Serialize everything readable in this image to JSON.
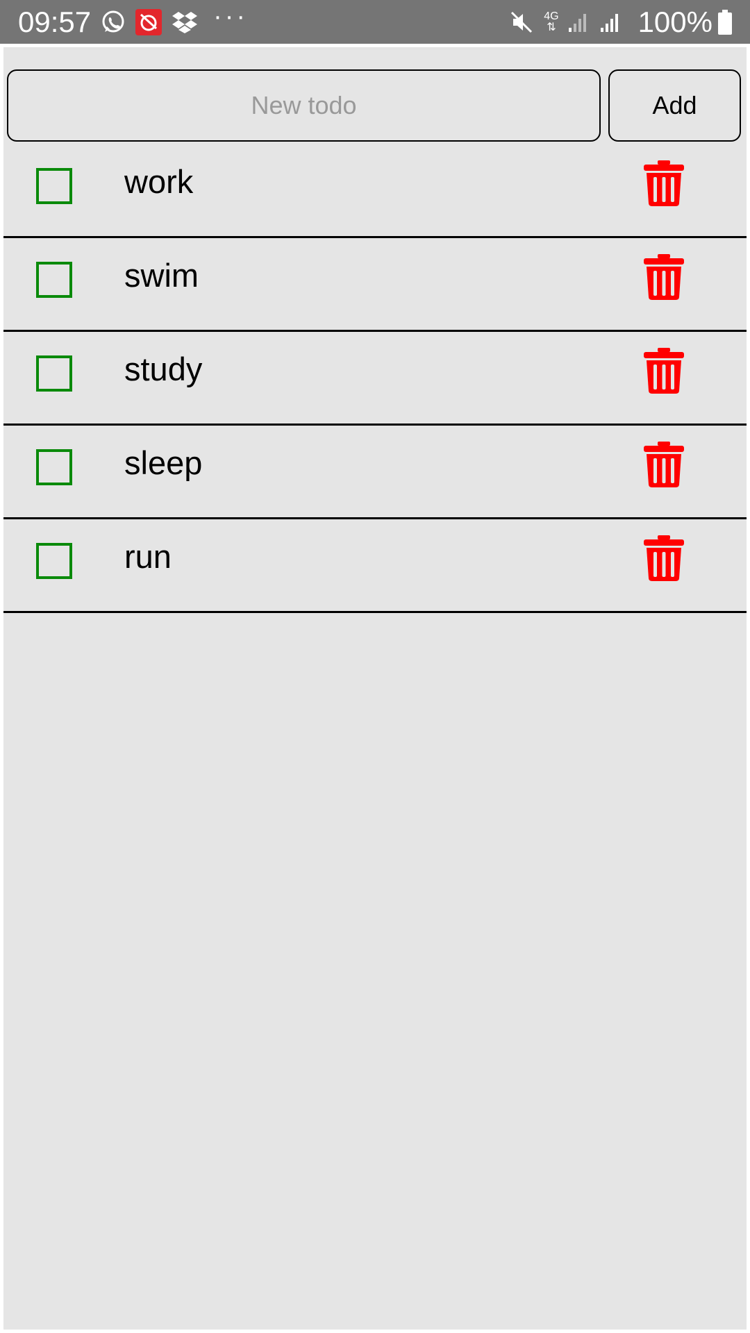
{
  "status_bar": {
    "time": "09:57",
    "network_type": "4G",
    "battery": "100%",
    "more_indicator": "···",
    "left_icons": [
      "whatsapp-icon",
      "telkomsel-app-icon",
      "dropbox-icon"
    ],
    "right_icons": [
      "mute-icon",
      "signal-icon",
      "signal-icon",
      "battery-icon"
    ]
  },
  "new_todo": {
    "placeholder": "New todo",
    "value": ""
  },
  "add_button": {
    "label": "Add"
  },
  "todos": [
    {
      "text": "work",
      "done": false
    },
    {
      "text": "swim",
      "done": false
    },
    {
      "text": "study",
      "done": false
    },
    {
      "text": "sleep",
      "done": false
    },
    {
      "text": "run",
      "done": false
    }
  ],
  "colors": {
    "status_bar": "#757575",
    "app_background": "#e5e5e5",
    "checkbox": "#0a8a0a",
    "delete": "#ff0000",
    "divider": "#000000"
  },
  "icons": {
    "delete": "trash-icon",
    "checkbox": "checkbox-unchecked"
  }
}
